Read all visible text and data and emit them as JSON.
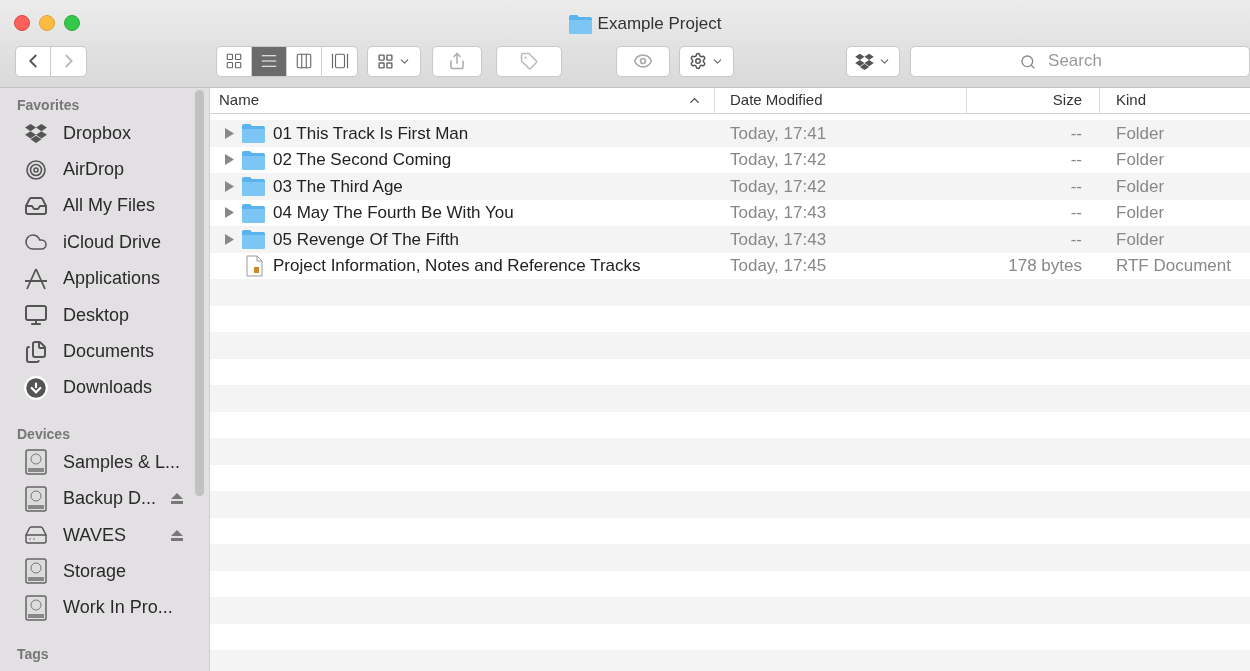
{
  "window": {
    "title": "Example Project"
  },
  "toolbar": {
    "view_modes": [
      {
        "selected": false
      },
      {
        "selected": true
      },
      {
        "selected": false
      },
      {
        "selected": false
      }
    ],
    "search": {
      "placeholder": "Search"
    }
  },
  "sidebar": {
    "sections": [
      {
        "heading": "Favorites",
        "items": [
          {
            "label": "Dropbox",
            "ejectable": false
          },
          {
            "label": "AirDrop",
            "ejectable": false
          },
          {
            "label": "All My Files",
            "ejectable": false
          },
          {
            "label": "iCloud Drive",
            "ejectable": false
          },
          {
            "label": "Applications",
            "ejectable": false
          },
          {
            "label": "Desktop",
            "ejectable": false
          },
          {
            "label": "Documents",
            "ejectable": false
          },
          {
            "label": "Downloads",
            "ejectable": false
          }
        ]
      },
      {
        "heading": "Devices",
        "items": [
          {
            "label": "Samples & L...",
            "ejectable": false
          },
          {
            "label": "Backup D...",
            "ejectable": true
          },
          {
            "label": "WAVES",
            "ejectable": true
          },
          {
            "label": "Storage",
            "ejectable": false
          },
          {
            "label": "Work In Pro...",
            "ejectable": false
          }
        ]
      },
      {
        "heading": "Tags"
      }
    ]
  },
  "table": {
    "columns": [
      {
        "label": "Name",
        "sorted": true
      },
      {
        "label": "Date Modified",
        "sorted": false
      },
      {
        "label": "Size",
        "sorted": false
      },
      {
        "label": "Kind",
        "sorted": false
      }
    ],
    "rows": [
      {
        "kind": "folder",
        "name": "01 This Track Is First Man",
        "date": "Today, 17:41",
        "size": "--",
        "type": "Folder"
      },
      {
        "kind": "folder",
        "name": "02 The Second Coming",
        "date": "Today, 17:42",
        "size": "--",
        "type": "Folder"
      },
      {
        "kind": "folder",
        "name": "03 The Third Age",
        "date": "Today, 17:42",
        "size": "--",
        "type": "Folder"
      },
      {
        "kind": "folder",
        "name": "04 May The Fourth Be With You",
        "date": "Today, 17:43",
        "size": "--",
        "type": "Folder"
      },
      {
        "kind": "folder",
        "name": "05 Revenge Of The Fifth",
        "date": "Today, 17:43",
        "size": "--",
        "type": "Folder"
      },
      {
        "kind": "document",
        "name": "Project Information, Notes and Reference Tracks",
        "date": "Today, 17:45",
        "size": "178 bytes",
        "type": "RTF Document"
      }
    ]
  }
}
